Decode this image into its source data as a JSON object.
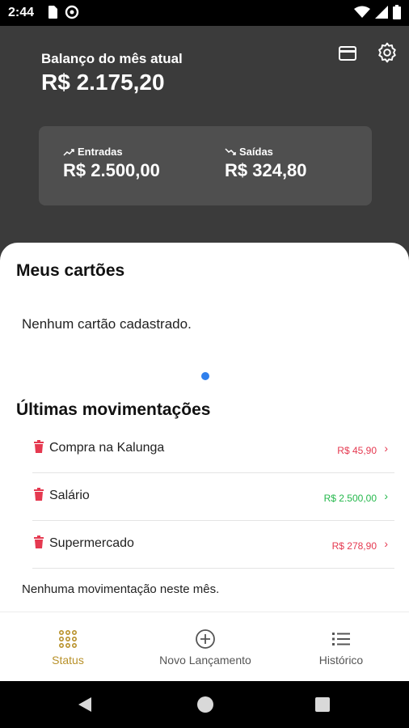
{
  "status_bar": {
    "time": "2:44",
    "icons": [
      "sim-card-icon",
      "sync-icon",
      "wifi-icon",
      "signal-icon",
      "battery-icon"
    ]
  },
  "header": {
    "balance_label": "Balanço do mês atual",
    "balance_value": "R$ 2.175,20",
    "actions": [
      "credit-card-icon",
      "gear-icon"
    ]
  },
  "summary": {
    "income_label": "Entradas",
    "income_value": "R$ 2.500,00",
    "expense_label": "Saídas",
    "expense_value": "R$ 324,80"
  },
  "cards": {
    "title": "Meus cartões",
    "empty_text": "Nenhum cartão cadastrado."
  },
  "movements": {
    "title": "Últimas movimentações",
    "items": [
      {
        "name": "Compra na Kalunga",
        "value": "R$ 45,90",
        "kind": "expense"
      },
      {
        "name": "Salário",
        "value": "R$ 2.500,00",
        "kind": "income"
      },
      {
        "name": "Supermercado",
        "value": "R$ 278,90",
        "kind": "expense"
      }
    ],
    "empty_text": "Nenhuma movimentação neste mês."
  },
  "nav": {
    "status_label": "Status",
    "new_label": "Novo Lançamento",
    "history_label": "Histórico",
    "active": "Status"
  },
  "colors": {
    "header_bg": "#3b3b3b",
    "accent_gold": "#b8912a",
    "expense_red": "#e53950",
    "income_green": "#25b84c",
    "dot_blue": "#2f80ed"
  }
}
